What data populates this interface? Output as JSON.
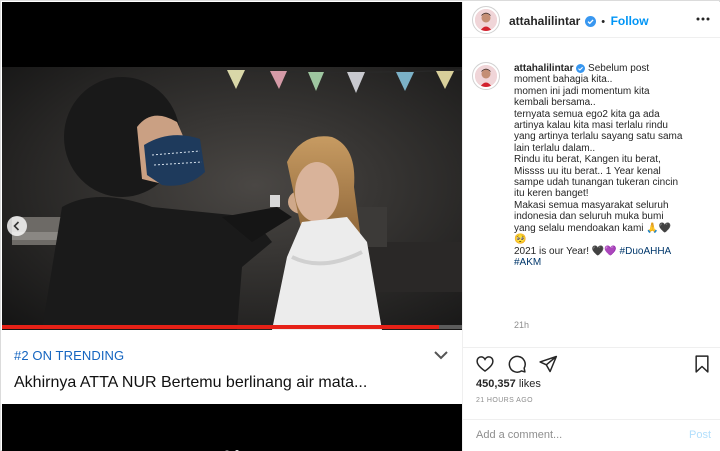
{
  "video": {
    "trending_label": "#2 ON TRENDING",
    "title": "Akhirnya ATTA NUR Bertemu berlinang air mata...",
    "progress": 0.95
  },
  "header": {
    "username": "attahalilintar",
    "separator": "•",
    "follow_label": "Follow"
  },
  "caption": {
    "username": "attahalilintar",
    "lines": [
      "Sebelum post",
      "moment bahagia kita..",
      "momen ini jadi momentum kita",
      "kembali bersama..",
      "ternyata semua ego2 kita ga ada",
      "artinya kalau kita masi terlalu rindu",
      "yang artinya terlalu sayang satu sama",
      "lain terlalu dalam..",
      "Rindu itu berat, Kangen itu berat,",
      "Missss uu itu berat.. 1 Year kenal",
      "sampe udah tunangan tukeran cincin",
      "itu keren banget!",
      "Makasi semua masyarakat seluruh",
      "indonesia dan seluruh muka bumi",
      "yang selalu mendoakan kami 🙏🖤",
      "🥺",
      "2021 is our Year! 🖤💜",
      "#AKM"
    ],
    "hashtag_inline": "#DuoAHHA",
    "time_ago": "21h"
  },
  "engagement": {
    "likes_count": "450,357",
    "likes_label": "likes",
    "timestamp": "21 HOURS AGO"
  },
  "comment_box": {
    "placeholder": "Add a comment...",
    "post_label": "Post"
  },
  "colors": {
    "accent": "#0095f6",
    "verified": "#3897f0",
    "trend_blue": "#1565c0",
    "progress_red": "#e62117"
  },
  "icons": {
    "like": "heart-icon",
    "comment": "comment-icon",
    "share": "paper-plane-icon",
    "save": "bookmark-icon",
    "more": "more-options-icon",
    "verified": "verified-badge-icon"
  }
}
